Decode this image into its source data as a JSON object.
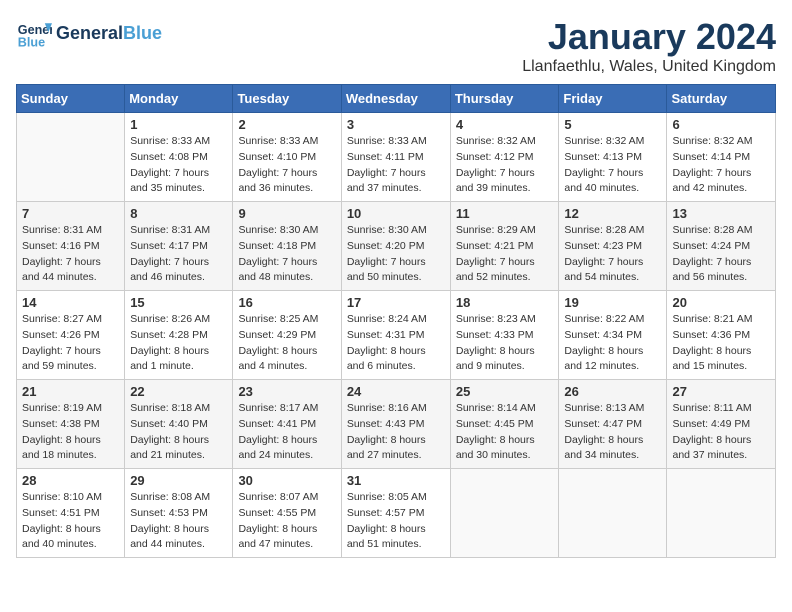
{
  "header": {
    "logo_line1": "General",
    "logo_line2": "Blue",
    "month_title": "January 2024",
    "location": "Llanfaethlu, Wales, United Kingdom"
  },
  "days_of_week": [
    "Sunday",
    "Monday",
    "Tuesday",
    "Wednesday",
    "Thursday",
    "Friday",
    "Saturday"
  ],
  "weeks": [
    [
      {
        "num": "",
        "info": ""
      },
      {
        "num": "1",
        "info": "Sunrise: 8:33 AM\nSunset: 4:08 PM\nDaylight: 7 hours\nand 35 minutes."
      },
      {
        "num": "2",
        "info": "Sunrise: 8:33 AM\nSunset: 4:10 PM\nDaylight: 7 hours\nand 36 minutes."
      },
      {
        "num": "3",
        "info": "Sunrise: 8:33 AM\nSunset: 4:11 PM\nDaylight: 7 hours\nand 37 minutes."
      },
      {
        "num": "4",
        "info": "Sunrise: 8:32 AM\nSunset: 4:12 PM\nDaylight: 7 hours\nand 39 minutes."
      },
      {
        "num": "5",
        "info": "Sunrise: 8:32 AM\nSunset: 4:13 PM\nDaylight: 7 hours\nand 40 minutes."
      },
      {
        "num": "6",
        "info": "Sunrise: 8:32 AM\nSunset: 4:14 PM\nDaylight: 7 hours\nand 42 minutes."
      }
    ],
    [
      {
        "num": "7",
        "info": "Sunrise: 8:31 AM\nSunset: 4:16 PM\nDaylight: 7 hours\nand 44 minutes."
      },
      {
        "num": "8",
        "info": "Sunrise: 8:31 AM\nSunset: 4:17 PM\nDaylight: 7 hours\nand 46 minutes."
      },
      {
        "num": "9",
        "info": "Sunrise: 8:30 AM\nSunset: 4:18 PM\nDaylight: 7 hours\nand 48 minutes."
      },
      {
        "num": "10",
        "info": "Sunrise: 8:30 AM\nSunset: 4:20 PM\nDaylight: 7 hours\nand 50 minutes."
      },
      {
        "num": "11",
        "info": "Sunrise: 8:29 AM\nSunset: 4:21 PM\nDaylight: 7 hours\nand 52 minutes."
      },
      {
        "num": "12",
        "info": "Sunrise: 8:28 AM\nSunset: 4:23 PM\nDaylight: 7 hours\nand 54 minutes."
      },
      {
        "num": "13",
        "info": "Sunrise: 8:28 AM\nSunset: 4:24 PM\nDaylight: 7 hours\nand 56 minutes."
      }
    ],
    [
      {
        "num": "14",
        "info": "Sunrise: 8:27 AM\nSunset: 4:26 PM\nDaylight: 7 hours\nand 59 minutes."
      },
      {
        "num": "15",
        "info": "Sunrise: 8:26 AM\nSunset: 4:28 PM\nDaylight: 8 hours\nand 1 minute."
      },
      {
        "num": "16",
        "info": "Sunrise: 8:25 AM\nSunset: 4:29 PM\nDaylight: 8 hours\nand 4 minutes."
      },
      {
        "num": "17",
        "info": "Sunrise: 8:24 AM\nSunset: 4:31 PM\nDaylight: 8 hours\nand 6 minutes."
      },
      {
        "num": "18",
        "info": "Sunrise: 8:23 AM\nSunset: 4:33 PM\nDaylight: 8 hours\nand 9 minutes."
      },
      {
        "num": "19",
        "info": "Sunrise: 8:22 AM\nSunset: 4:34 PM\nDaylight: 8 hours\nand 12 minutes."
      },
      {
        "num": "20",
        "info": "Sunrise: 8:21 AM\nSunset: 4:36 PM\nDaylight: 8 hours\nand 15 minutes."
      }
    ],
    [
      {
        "num": "21",
        "info": "Sunrise: 8:19 AM\nSunset: 4:38 PM\nDaylight: 8 hours\nand 18 minutes."
      },
      {
        "num": "22",
        "info": "Sunrise: 8:18 AM\nSunset: 4:40 PM\nDaylight: 8 hours\nand 21 minutes."
      },
      {
        "num": "23",
        "info": "Sunrise: 8:17 AM\nSunset: 4:41 PM\nDaylight: 8 hours\nand 24 minutes."
      },
      {
        "num": "24",
        "info": "Sunrise: 8:16 AM\nSunset: 4:43 PM\nDaylight: 8 hours\nand 27 minutes."
      },
      {
        "num": "25",
        "info": "Sunrise: 8:14 AM\nSunset: 4:45 PM\nDaylight: 8 hours\nand 30 minutes."
      },
      {
        "num": "26",
        "info": "Sunrise: 8:13 AM\nSunset: 4:47 PM\nDaylight: 8 hours\nand 34 minutes."
      },
      {
        "num": "27",
        "info": "Sunrise: 8:11 AM\nSunset: 4:49 PM\nDaylight: 8 hours\nand 37 minutes."
      }
    ],
    [
      {
        "num": "28",
        "info": "Sunrise: 8:10 AM\nSunset: 4:51 PM\nDaylight: 8 hours\nand 40 minutes."
      },
      {
        "num": "29",
        "info": "Sunrise: 8:08 AM\nSunset: 4:53 PM\nDaylight: 8 hours\nand 44 minutes."
      },
      {
        "num": "30",
        "info": "Sunrise: 8:07 AM\nSunset: 4:55 PM\nDaylight: 8 hours\nand 47 minutes."
      },
      {
        "num": "31",
        "info": "Sunrise: 8:05 AM\nSunset: 4:57 PM\nDaylight: 8 hours\nand 51 minutes."
      },
      {
        "num": "",
        "info": ""
      },
      {
        "num": "",
        "info": ""
      },
      {
        "num": "",
        "info": ""
      }
    ]
  ]
}
